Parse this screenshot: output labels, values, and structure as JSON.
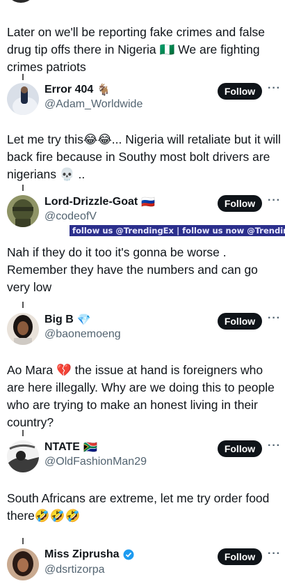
{
  "posts": [
    {
      "text": "Later on we'll be reporting fake crimes and false drug tip offs there in Nigeria 🇳🇬 We are fighting crimes patriots"
    },
    {
      "name": "Error 404",
      "badge": "🐐",
      "handle": "@Adam_Worldwide",
      "follow": "Follow",
      "text": "Let me try this😂😂... Nigeria will retaliate but it will back fire because in Southy most bolt drivers are nigerians 💀 .."
    },
    {
      "name": "Lord-Drizzle-Goat",
      "badge": "🇷🇺",
      "handle": "@codeofV",
      "follow": "Follow",
      "text": "Nah if they do it too it's gonna be worse . Remember they have the numbers and can go very low"
    },
    {
      "name": "Big B",
      "badge": "💎",
      "handle": "@baonemoeng",
      "follow": "Follow",
      "text": "Ao Mara 💔  the issue at hand is foreigners who are here illegally. Why are we doing this to people who are trying to make an honest living in their country?"
    },
    {
      "name": "NTATE",
      "badge": "🇿🇦",
      "handle": "@OldFashionMan29",
      "follow": "Follow",
      "text": "South Africans are extreme, let me try order food there🤣🤣🤣"
    },
    {
      "name": "Miss Ziprusha",
      "handle": "@dsrtizorpa",
      "follow": "Follow"
    }
  ],
  "watermark": "follow us @TrendingEx | follow us now @TrendingEx",
  "more_glyph": "···",
  "colors": {
    "follow_bg": "#0f1419",
    "banner_bg": "#2b2f8c",
    "handle": "#536471"
  }
}
